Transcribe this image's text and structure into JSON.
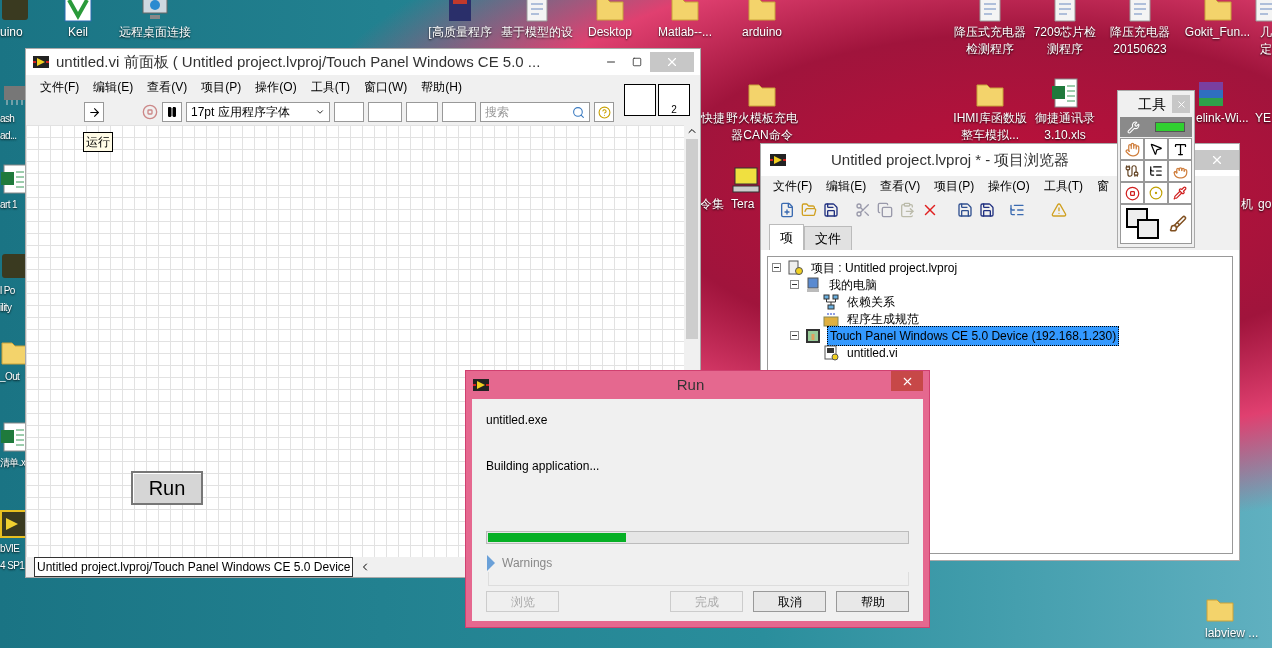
{
  "desktop_icons": [
    {
      "kind": "app",
      "label": "uino"
    },
    {
      "kind": "keil",
      "label": "Keil"
    },
    {
      "kind": "network",
      "label": "远程桌面连接"
    },
    {
      "kind": "book",
      "label": "[高质量程序"
    },
    {
      "kind": "doc",
      "label": "基于模型的设"
    },
    {
      "kind": "folder",
      "label": "Desktop"
    },
    {
      "kind": "folder",
      "label": "Matlab--..."
    },
    {
      "kind": "folder",
      "label": "arduino"
    },
    {
      "kind": "doc",
      "label": "降压式充电器检测程序"
    },
    {
      "kind": "doc",
      "label": "7209芯片检测程序"
    },
    {
      "kind": "doc",
      "label": "降压充电器\n20150623"
    },
    {
      "kind": "folder",
      "label": "Gokit_Fun..."
    },
    {
      "kind": "doc",
      "label": "几定"
    },
    {
      "kind": "none",
      "label": "快捷"
    },
    {
      "kind": "folder",
      "label": "野火模板充电器CAN命令"
    },
    {
      "kind": "folder",
      "label": "IHMI库函数版整车模拟..."
    },
    {
      "kind": "excel",
      "label": "御捷通讯录\n3.10.xls"
    },
    {
      "kind": "rar",
      "label": "elink-Wi..."
    },
    {
      "kind": "none",
      "label": "YE"
    },
    {
      "kind": "none",
      "label": "令集"
    },
    {
      "kind": "computer",
      "label": "Tera"
    },
    {
      "kind": "none",
      "label": "机"
    },
    {
      "kind": "none",
      "label": "go"
    },
    {
      "kind": "chip",
      "label": "ash\nad..."
    },
    {
      "kind": "excel",
      "label": "art 1"
    },
    {
      "kind": "app",
      "label": "l Po\nility"
    },
    {
      "kind": "folder",
      "label": "_Out"
    },
    {
      "kind": "excel",
      "label": "清单.x"
    },
    {
      "kind": "labview",
      "label": "bVIE\n4 SP1"
    },
    {
      "kind": "folder",
      "label": "labview ..."
    }
  ],
  "front_panel": {
    "title": "untitled.vi 前面板 ( Untitled project.lvproj/Touch Panel Windows CE 5.0 ...",
    "menu": [
      "文件(F)",
      "编辑(E)",
      "查看(V)",
      "项目(P)",
      "操作(O)",
      "工具(T)",
      "窗口(W)",
      "帮助(H)"
    ],
    "font": "17pt 应用程序字体",
    "search_placeholder": "搜索",
    "connector_count": "2",
    "label": "运行",
    "button": "Run",
    "status": "Untitled project.lvproj/Touch Panel Windows CE 5.0 Device"
  },
  "tools_palette": {
    "title": "工具"
  },
  "project_explorer": {
    "title": "Untitled project.lvproj * - 项目浏览器",
    "menu": [
      "文件(F)",
      "编辑(E)",
      "查看(V)",
      "项目(P)",
      "操作(O)",
      "工具(T)",
      "窗"
    ],
    "tabs": [
      {
        "label": "项",
        "selected": true
      },
      {
        "label": "文件",
        "selected": false
      }
    ],
    "tree": [
      {
        "kind": "project",
        "label": "项目 : Untitled project.lvproj",
        "selected": false,
        "expanded": true,
        "children": [
          {
            "kind": "computer",
            "label": "我的电脑",
            "selected": false,
            "expanded": true,
            "children": [
              {
                "kind": "deps",
                "label": "依赖关系",
                "selected": false
              },
              {
                "kind": "build",
                "label": "程序生成规范",
                "selected": false
              }
            ]
          },
          {
            "kind": "target",
            "label": "Touch Panel Windows CE 5.0 Device (192.168.1.230)",
            "selected": true,
            "expanded": true,
            "children": [
              {
                "kind": "vi",
                "label": "untitled.vi",
                "selected": false
              }
            ]
          }
        ]
      }
    ]
  },
  "run_dialog": {
    "title": "Run",
    "file": "untitled.exe",
    "status": "Building application...",
    "progress": {
      "level": 0.33
    },
    "warnings": {
      "label": "Warnings",
      "expanded": false
    },
    "buttons": [
      {
        "label": "浏览",
        "disabled": true
      },
      {
        "label": "完成",
        "disabled": true
      },
      {
        "label": "取消",
        "disabled": false
      },
      {
        "label": "帮助",
        "disabled": false
      }
    ]
  }
}
